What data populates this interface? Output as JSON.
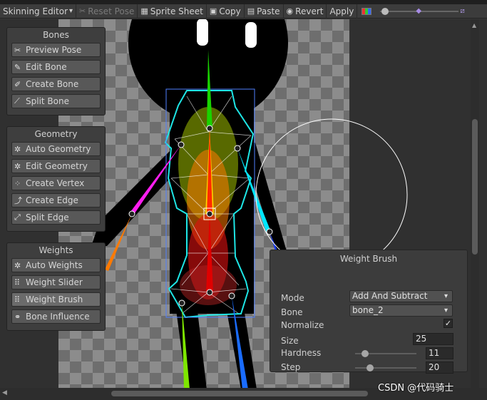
{
  "toolbar": {
    "mode_label": "Skinning Editor",
    "reset_pose_label": "Reset Pose",
    "sprite_sheet_label": "Sprite Sheet",
    "copy_label": "Copy",
    "paste_label": "Paste",
    "revert_label": "Revert",
    "apply_label": "Apply",
    "icons": {
      "reset_pose": "reset-pose-icon",
      "sprite_sheet": "grid-icon",
      "copy": "copy-icon",
      "paste": "paste-icon",
      "revert": "eye-icon",
      "color": "color-toggle-icon"
    }
  },
  "bones_panel": {
    "title": "Bones",
    "items": [
      {
        "label": "Preview Pose",
        "icon": "preview-pose-icon"
      },
      {
        "label": "Edit Bone",
        "icon": "edit-bone-icon"
      },
      {
        "label": "Create Bone",
        "icon": "create-bone-icon"
      },
      {
        "label": "Split Bone",
        "icon": "split-bone-icon"
      }
    ]
  },
  "geometry_panel": {
    "title": "Geometry",
    "items": [
      {
        "label": "Auto Geometry",
        "icon": "auto-geometry-icon"
      },
      {
        "label": "Edit Geometry",
        "icon": "edit-geometry-icon"
      },
      {
        "label": "Create Vertex",
        "icon": "create-vertex-icon"
      },
      {
        "label": "Create Edge",
        "icon": "create-edge-icon"
      },
      {
        "label": "Split Edge",
        "icon": "split-edge-icon"
      }
    ]
  },
  "weights_panel": {
    "title": "Weights",
    "items": [
      {
        "label": "Auto Weights",
        "icon": "auto-weights-icon"
      },
      {
        "label": "Weight Slider",
        "icon": "weight-slider-icon"
      },
      {
        "label": "Weight Brush",
        "icon": "weight-brush-icon",
        "active": true
      },
      {
        "label": "Bone Influence",
        "icon": "bone-influence-icon"
      }
    ]
  },
  "weight_brush": {
    "title": "Weight Brush",
    "mode_label": "Mode",
    "mode_value": "Add And Subtract",
    "bone_label": "Bone",
    "bone_value": "bone_2",
    "normalize_label": "Normalize",
    "normalize_checked": true,
    "size_label": "Size",
    "size_value": "25",
    "hardness_label": "Hardness",
    "hardness_value": "11",
    "step_label": "Step",
    "step_value": "20"
  },
  "watermark": "CSDN @代码骑士",
  "colors": {
    "accent_bone_spine": "#ff2a00",
    "bone_head": "#19d400",
    "mesh_outline": "#1ee6e6",
    "brush_circle": "#ffffff"
  }
}
